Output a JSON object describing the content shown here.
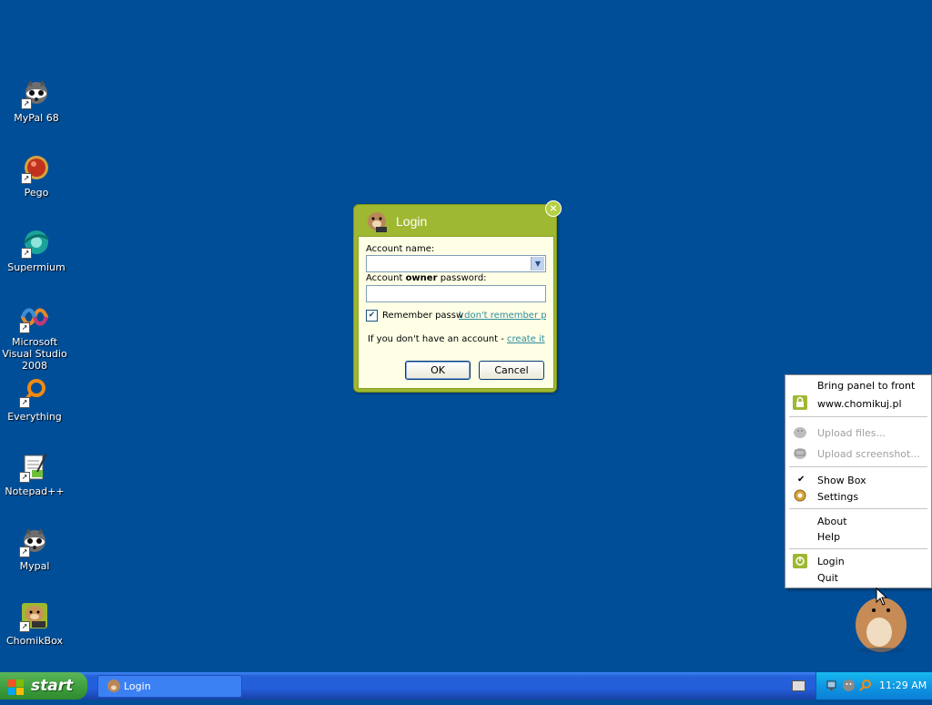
{
  "desktop": {
    "icons": [
      {
        "label": "MyPal 68"
      },
      {
        "label": "Pego"
      },
      {
        "label": "Supermium"
      },
      {
        "label": "Microsoft Visual Studio 2008"
      },
      {
        "label": "Everything"
      },
      {
        "label": "Notepad++"
      },
      {
        "label": "Mypal"
      },
      {
        "label": "ChomikBox"
      }
    ]
  },
  "dialog": {
    "title": "Login",
    "account_name_label": "Account name:",
    "password_label_pre": "Account ",
    "password_label_bold": "owner",
    "password_label_post": " password:",
    "account_name_value": "",
    "password_value": "",
    "remember_label": "Remember passw",
    "remember_checked": true,
    "forgot_link": "I don't remember pas",
    "no_account_text": "If you don't have an account - ",
    "create_link": "create it",
    "ok_label": "OK",
    "cancel_label": "Cancel"
  },
  "context_menu": {
    "items": [
      {
        "label": "Bring panel to front",
        "enabled": true
      },
      {
        "label": "www.chomikuj.pl",
        "enabled": true,
        "icon": "lock-icon"
      },
      {
        "label": "Upload files...",
        "enabled": false,
        "icon": "upload-files-icon"
      },
      {
        "label": "Upload screenshot...",
        "enabled": false,
        "icon": "upload-screenshot-icon"
      },
      {
        "label": "Show Box",
        "enabled": true,
        "checked": true
      },
      {
        "label": "Settings",
        "enabled": true,
        "icon": "gear-icon"
      },
      {
        "label": "About",
        "enabled": true
      },
      {
        "label": "Help",
        "enabled": true
      },
      {
        "label": "Login",
        "enabled": true,
        "icon": "power-icon"
      },
      {
        "label": "Quit",
        "enabled": true
      }
    ]
  },
  "taskbar": {
    "start_label": "start",
    "tasks": [
      {
        "label": "Login"
      }
    ],
    "clock": "11:29 AM"
  },
  "colors": {
    "desktop": "#004e98",
    "dialog_frame": "#9eb832",
    "dialog_body": "#ffffe6",
    "link": "#2e8b9b"
  }
}
